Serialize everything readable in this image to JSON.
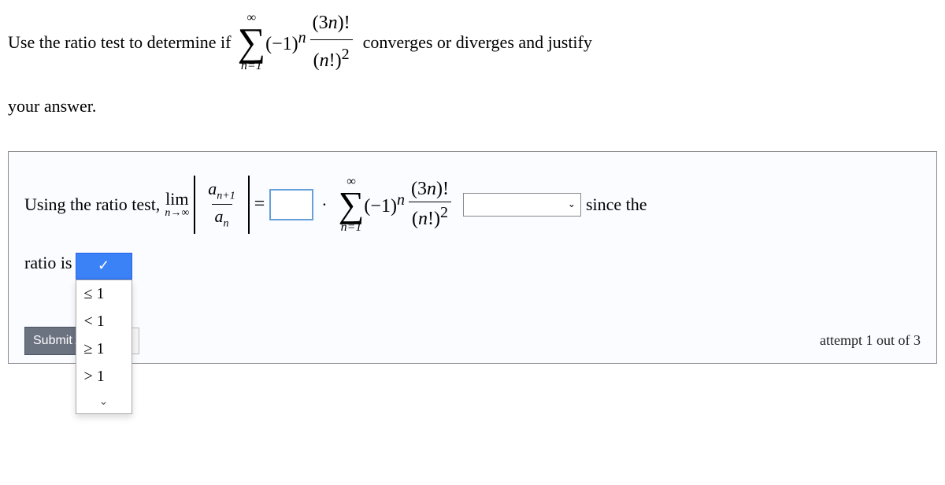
{
  "question": {
    "prefix": "Use the ratio test to determine if",
    "sigma_top": "∞",
    "sigma_bottom_var": "n",
    "sigma_bottom_eq": "=1",
    "term_base": "(−1)",
    "term_exp": "n",
    "frac_num_a": "(3",
    "frac_num_var": "n",
    "frac_num_b": ")!",
    "frac_den_a": "(",
    "frac_den_var": "n",
    "frac_den_b": "!)",
    "frac_den_exp": "2",
    "suffix": "converges or diverges and justify",
    "line2": "your answer."
  },
  "answer": {
    "prefix": "Using the ratio test,",
    "lim": "lim",
    "lim_sub_var": "n",
    "lim_sub_arrow": "→∞",
    "ratio_num_a": "a",
    "ratio_num_sub": "n+1",
    "ratio_den_a": "a",
    "ratio_den_sub": "n",
    "equals": "=",
    "dot": "·",
    "since": "since the",
    "ratio_label": "ratio is"
  },
  "dropdown": {
    "selected": "✓",
    "opt1": "≤ 1",
    "opt2": "< 1",
    "opt3": "≥ 1",
    "opt4": "> 1"
  },
  "submit": {
    "label": "Submit A",
    "infinity": "∞"
  },
  "attempt": {
    "text": "attempt 1 out of 3"
  }
}
